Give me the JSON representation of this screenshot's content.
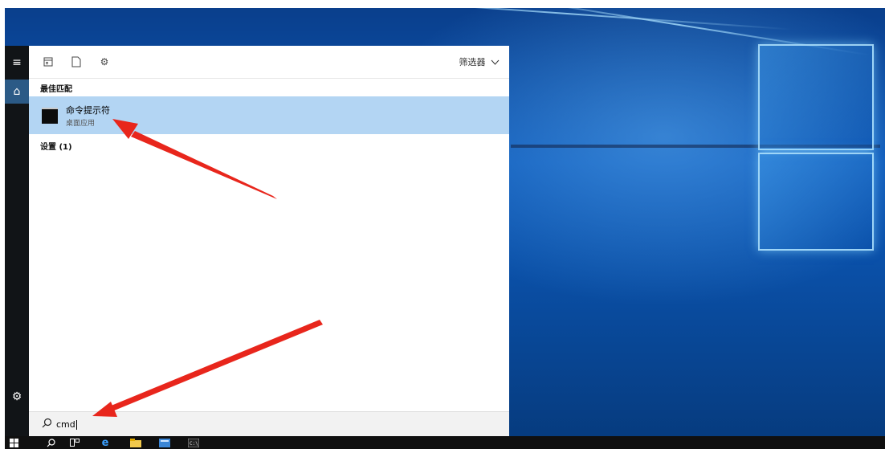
{
  "start_menu": {
    "top_icons": [
      "all-apps-icon",
      "documents-icon",
      "settings-icon"
    ],
    "filter_label": "筛选器",
    "best_match": {
      "section_title": "最佳匹配",
      "app_name": "命令提示符",
      "app_type": "桌面应用"
    },
    "settings_section_title": "设置 (1)",
    "search": {
      "value": "cmd"
    }
  },
  "rail": {
    "items": [
      "menu-icon",
      "home-icon",
      "settings-icon"
    ]
  },
  "taskbar": {
    "items": [
      "start-icon",
      "search-icon",
      "task-view-icon",
      "edge-icon",
      "file-explorer-icon",
      "server-manager-icon",
      "cmd-icon"
    ]
  },
  "colors": {
    "highlight": "#b3d5f3",
    "annotation_arrow": "#e8261c",
    "desktop_blue": "#0b57b8"
  }
}
